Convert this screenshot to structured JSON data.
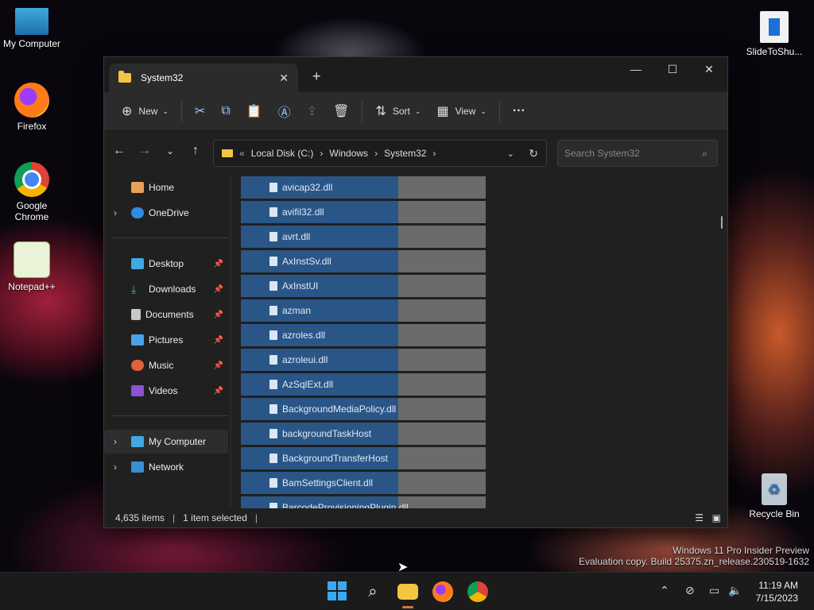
{
  "desktop": {
    "icons": [
      {
        "label": "My Computer"
      },
      {
        "label": "Firefox"
      },
      {
        "label": "Google Chrome"
      },
      {
        "label": "Notepad++"
      },
      {
        "label": "SlideToShu..."
      },
      {
        "label": "Recycle Bin"
      }
    ],
    "watermark_line1": "Windows 11 Pro Insider Preview",
    "watermark_line2": "Evaluation copy. Build 25375.zn_release.230519-1632"
  },
  "window": {
    "tab_title": "System32",
    "new_tab": "+",
    "controls": {
      "minimize": "—",
      "maximize": "☐",
      "close": "✕"
    }
  },
  "toolbar": {
    "new_label": "New",
    "sort_label": "Sort",
    "view_label": "View",
    "more_label": "···"
  },
  "address": {
    "prefix": "«",
    "crumbs": [
      "Local Disk (C:)",
      "Windows",
      "System32"
    ],
    "search_placeholder": "Search System32"
  },
  "sidebar": {
    "items": [
      {
        "label": "Home"
      },
      {
        "label": "OneDrive"
      },
      {
        "label": "Desktop"
      },
      {
        "label": "Downloads"
      },
      {
        "label": "Documents"
      },
      {
        "label": "Pictures"
      },
      {
        "label": "Music"
      },
      {
        "label": "Videos"
      },
      {
        "label": "My Computer"
      },
      {
        "label": "Network"
      }
    ]
  },
  "files": [
    "avicap32.dll",
    "avifil32.dll",
    "avrt.dll",
    "AxInstSv.dll",
    "AxInstUI",
    "azman",
    "azroles.dll",
    "azroleui.dll",
    "AzSqlExt.dll",
    "BackgroundMediaPolicy.dll",
    "backgroundTaskHost",
    "BackgroundTransferHost",
    "BamSettingsClient.dll",
    "BarcodeProvisioningPlugin.dll"
  ],
  "status": {
    "count": "4,635 items",
    "selected": "1 item selected"
  },
  "taskbar": {
    "time": "11:19 AM",
    "date": "7/15/2023"
  },
  "colors": {
    "accent": "#2a5687",
    "window_bg": "#202020",
    "folder_yellow": "#f4c542"
  }
}
